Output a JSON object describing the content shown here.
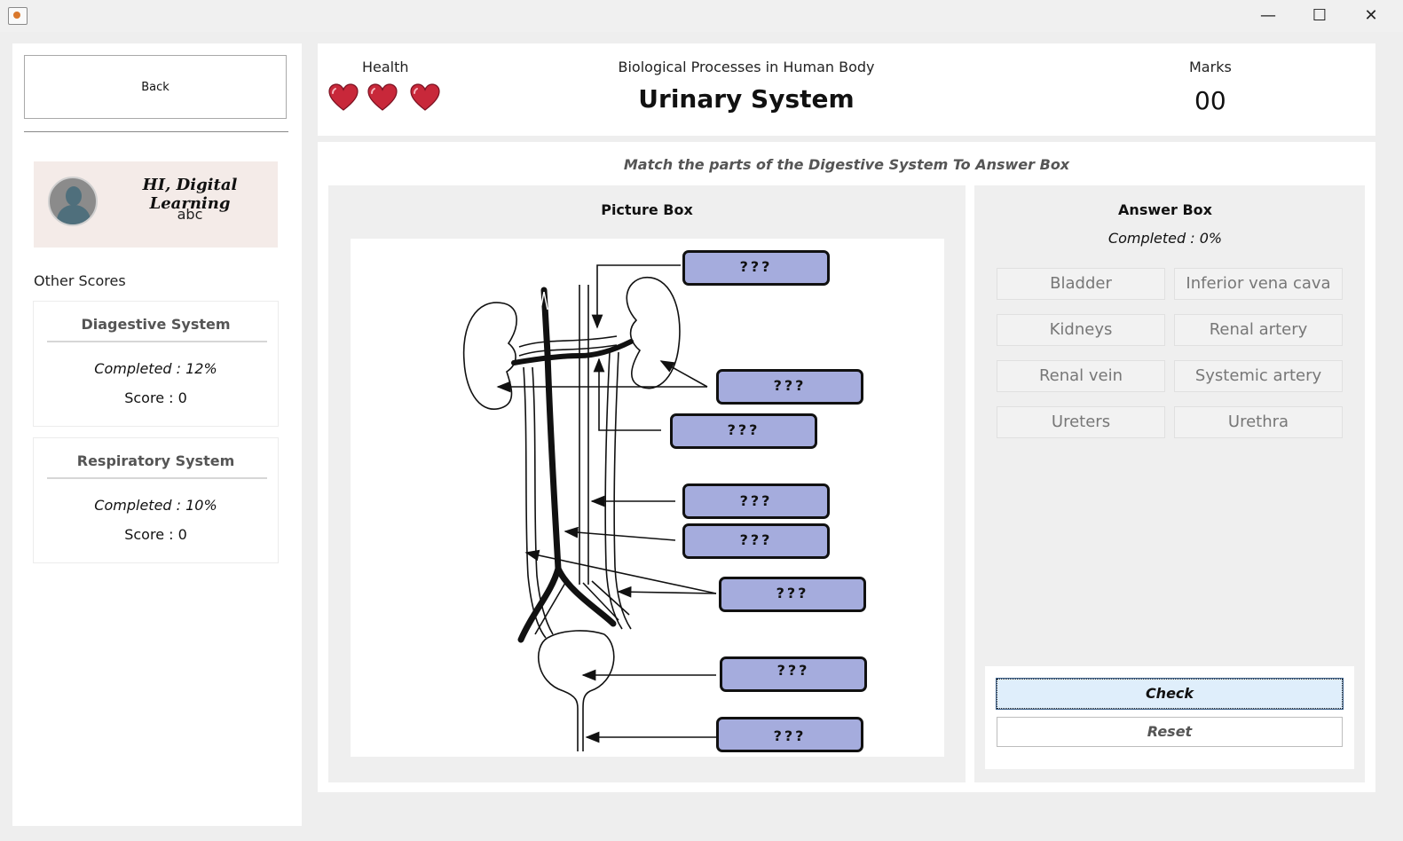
{
  "window": {
    "minimize_glyph": "—",
    "maximize_glyph": "☐",
    "close_glyph": "✕"
  },
  "sidebar": {
    "back_label": "Back",
    "greeting": "HI, Digital Learning",
    "username": "abc",
    "other_scores_label": "Other Scores",
    "scores": [
      {
        "title": "Diagestive System",
        "completed": "Completed : 12%",
        "score": "Score : 0"
      },
      {
        "title": "Respiratory System",
        "completed": "Completed : 10%",
        "score": "Score : 0"
      }
    ]
  },
  "header": {
    "health_label": "Health",
    "health_count": 3,
    "subtitle": "Biological Processes in  Human Body",
    "title": "Urinary System",
    "marks_label": "Marks",
    "marks_value": "00"
  },
  "main": {
    "instruction": "Match the parts of the Digestive System To Answer Box",
    "picture_box": {
      "title": "Picture Box",
      "labels": [
        "???",
        "???",
        "???",
        "???",
        "???",
        "???",
        "???",
        "???"
      ]
    },
    "answer_box": {
      "title": "Answer Box",
      "progress": "Completed : 0%",
      "answers": [
        "Bladder",
        "Inferior vena cava",
        "Kidneys",
        "Renal artery",
        "Renal vein",
        "Systemic artery",
        "Ureters",
        "Urethra"
      ],
      "check_label": "Check",
      "reset_label": "Reset"
    }
  },
  "colors": {
    "label_fill": "#a5acdd",
    "heart": "#c8283a",
    "profile_bg": "#f4ebe8",
    "check_bg": "#dfeefb"
  },
  "icons": [
    "app-icon",
    "minimize-icon",
    "maximize-icon",
    "close-icon",
    "avatar-icon",
    "heart-icon"
  ]
}
